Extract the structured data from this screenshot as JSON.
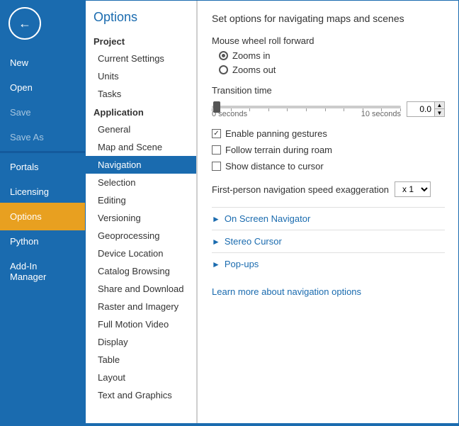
{
  "sidebar": {
    "items": [
      {
        "id": "new",
        "label": "New",
        "active": false,
        "disabled": false
      },
      {
        "id": "open",
        "label": "Open",
        "active": false,
        "disabled": false
      },
      {
        "id": "save",
        "label": "Save",
        "active": false,
        "disabled": true
      },
      {
        "id": "save-as",
        "label": "Save As",
        "active": false,
        "disabled": true
      },
      {
        "id": "portals",
        "label": "Portals",
        "active": false,
        "disabled": false
      },
      {
        "id": "licensing",
        "label": "Licensing",
        "active": false,
        "disabled": false
      },
      {
        "id": "options",
        "label": "Options",
        "active": true,
        "disabled": false
      },
      {
        "id": "python",
        "label": "Python",
        "active": false,
        "disabled": false
      },
      {
        "id": "addin",
        "label": "Add-In Manager",
        "active": false,
        "disabled": false
      }
    ]
  },
  "middle": {
    "title": "Options",
    "sections": [
      {
        "header": "Project",
        "items": [
          "Current Settings",
          "Units",
          "Tasks"
        ]
      },
      {
        "header": "Application",
        "items": [
          "General",
          "Map and Scene",
          "Navigation",
          "Selection",
          "Editing",
          "Versioning",
          "Geoprocessing",
          "Device Location",
          "Catalog Browsing",
          "Share and Download",
          "Raster and Imagery",
          "Full Motion Video",
          "Display",
          "Table",
          "Layout",
          "Text and Graphics"
        ]
      }
    ],
    "selected": "Navigation"
  },
  "content": {
    "title": "Set options for navigating maps and scenes",
    "mouse_wheel_label": "Mouse wheel roll forward",
    "radio_options": [
      {
        "id": "zoom-in",
        "label": "Zooms in",
        "checked": true
      },
      {
        "id": "zoom-out",
        "label": "Zooms out",
        "checked": false
      }
    ],
    "transition_label": "Transition time",
    "slider_min_label": "0 seconds",
    "slider_max_label": "10 seconds",
    "slider_value": "0.0",
    "checkboxes": [
      {
        "id": "panning",
        "label": "Enable panning gestures",
        "checked": true
      },
      {
        "id": "terrain",
        "label": "Follow terrain during roam",
        "checked": false
      },
      {
        "id": "distance",
        "label": "Show distance to cursor",
        "checked": false
      }
    ],
    "speed_label": "First-person navigation speed exaggeration",
    "speed_value": "x 1",
    "expandable": [
      {
        "label": "On Screen Navigator"
      },
      {
        "label": "Stereo Cursor"
      },
      {
        "label": "Pop-ups"
      }
    ],
    "learn_link": "Learn more about navigation options"
  }
}
